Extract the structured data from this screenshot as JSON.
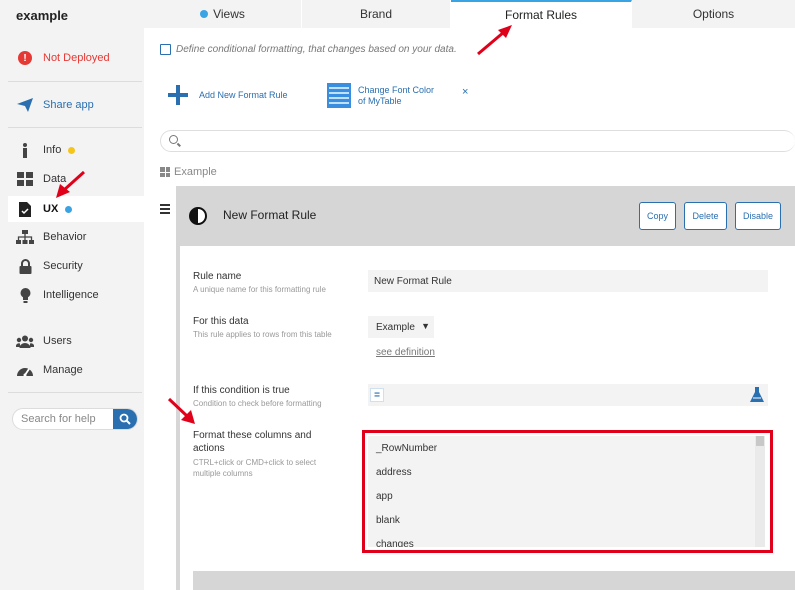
{
  "app": {
    "name": "example"
  },
  "sidebar": {
    "deploy_status": "Not Deployed",
    "share": "Share app",
    "items": [
      {
        "label": "Info",
        "dot": "yellow"
      },
      {
        "label": "Data",
        "dot": ""
      },
      {
        "label": "UX",
        "dot": "blue"
      },
      {
        "label": "Behavior",
        "dot": ""
      },
      {
        "label": "Security",
        "dot": ""
      },
      {
        "label": "Intelligence",
        "dot": ""
      },
      {
        "label": "Users",
        "dot": ""
      },
      {
        "label": "Manage",
        "dot": ""
      }
    ],
    "search_placeholder": "Search for help"
  },
  "tabs": [
    {
      "label": "Views"
    },
    {
      "label": "Brand"
    },
    {
      "label": "Format Rules"
    },
    {
      "label": "Options"
    }
  ],
  "main": {
    "hint": "Define conditional formatting, that changes based on your data.",
    "add_rule": "Add New Format Rule",
    "rule_chip": {
      "title": "Change Font Color",
      "subtitle": "of MyTable",
      "close": "×"
    },
    "example_label": "Example"
  },
  "rule": {
    "title": "New Format Rule",
    "buttons": {
      "copy": "Copy",
      "delete": "Delete",
      "disable": "Disable"
    },
    "rule_name": {
      "label": "Rule name",
      "sub": "A unique name for this formatting rule",
      "value": "New Format Rule"
    },
    "for_data": {
      "label": "For this data",
      "sub": "This rule applies to rows from this table",
      "value": "Example",
      "link": "see definition"
    },
    "condition": {
      "label": "If this condition is true",
      "sub": "Condition to check before formatting",
      "eq": "="
    },
    "columns": {
      "label": "Format these columns and actions",
      "sub": "CTRL+click or CMD+click to select multiple columns",
      "options": [
        "_RowNumber",
        "address",
        "app",
        "blank",
        "changes"
      ]
    }
  },
  "colors": {
    "accent": "#2a6fb0",
    "highlight": "#e1001a",
    "tab_accent": "#3aa3e3",
    "alert": "#e53935"
  }
}
